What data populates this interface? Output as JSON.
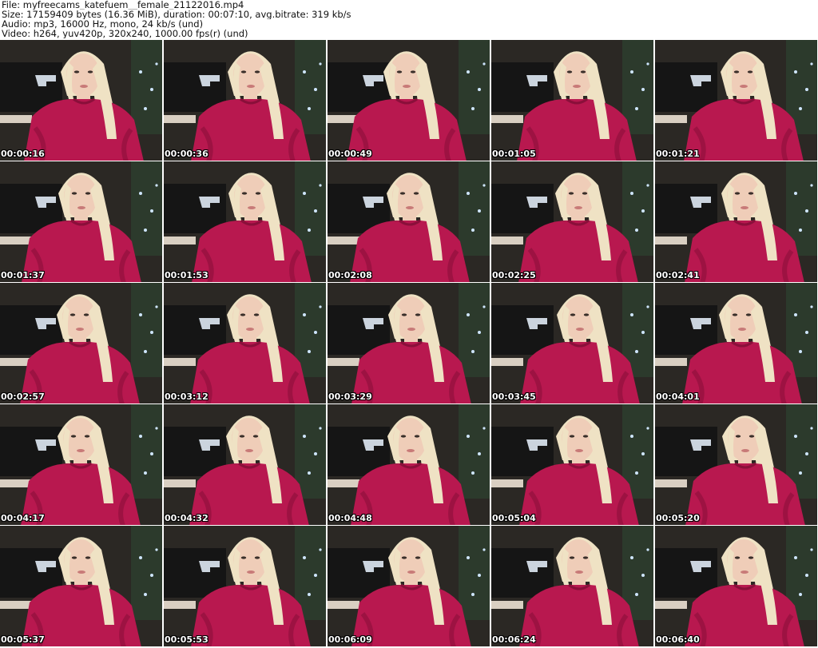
{
  "header": {
    "file_line": "File: myfreecams_katefuem__female_21122016.mp4",
    "size_line": "Size: 17159409 bytes (16.36 MiB), duration: 00:07:10, avg.bitrate: 319 kb/s",
    "audio_line": "Audio: mp3, 16000 Hz, mono, 24 kb/s (und)",
    "video_line": "Video: h264, yuv420p, 320x240, 1000.00 fps(r) (und)"
  },
  "frames": [
    {
      "timestamp": "00:00:16"
    },
    {
      "timestamp": "00:00:36"
    },
    {
      "timestamp": "00:00:49"
    },
    {
      "timestamp": "00:01:05"
    },
    {
      "timestamp": "00:01:21"
    },
    {
      "timestamp": "00:01:37"
    },
    {
      "timestamp": "00:01:53"
    },
    {
      "timestamp": "00:02:08"
    },
    {
      "timestamp": "00:02:25"
    },
    {
      "timestamp": "00:02:41"
    },
    {
      "timestamp": "00:02:57"
    },
    {
      "timestamp": "00:03:12"
    },
    {
      "timestamp": "00:03:29"
    },
    {
      "timestamp": "00:03:45"
    },
    {
      "timestamp": "00:04:01"
    },
    {
      "timestamp": "00:04:17"
    },
    {
      "timestamp": "00:04:32"
    },
    {
      "timestamp": "00:04:48"
    },
    {
      "timestamp": "00:05:04"
    },
    {
      "timestamp": "00:05:20"
    },
    {
      "timestamp": "00:05:37"
    },
    {
      "timestamp": "00:05:53"
    },
    {
      "timestamp": "00:06:09"
    },
    {
      "timestamp": "00:06:24"
    },
    {
      "timestamp": "00:06:40"
    }
  ],
  "colors": {
    "sweater": "#b8184f",
    "sweater_shadow": "#8a0f3a",
    "hair": "#efe2c4",
    "skin": "#efcdb8",
    "wall": "#2b2824",
    "monitor": "#151515",
    "monitor_glow": "#dfe9f4",
    "tree": "#2c3a2c"
  }
}
